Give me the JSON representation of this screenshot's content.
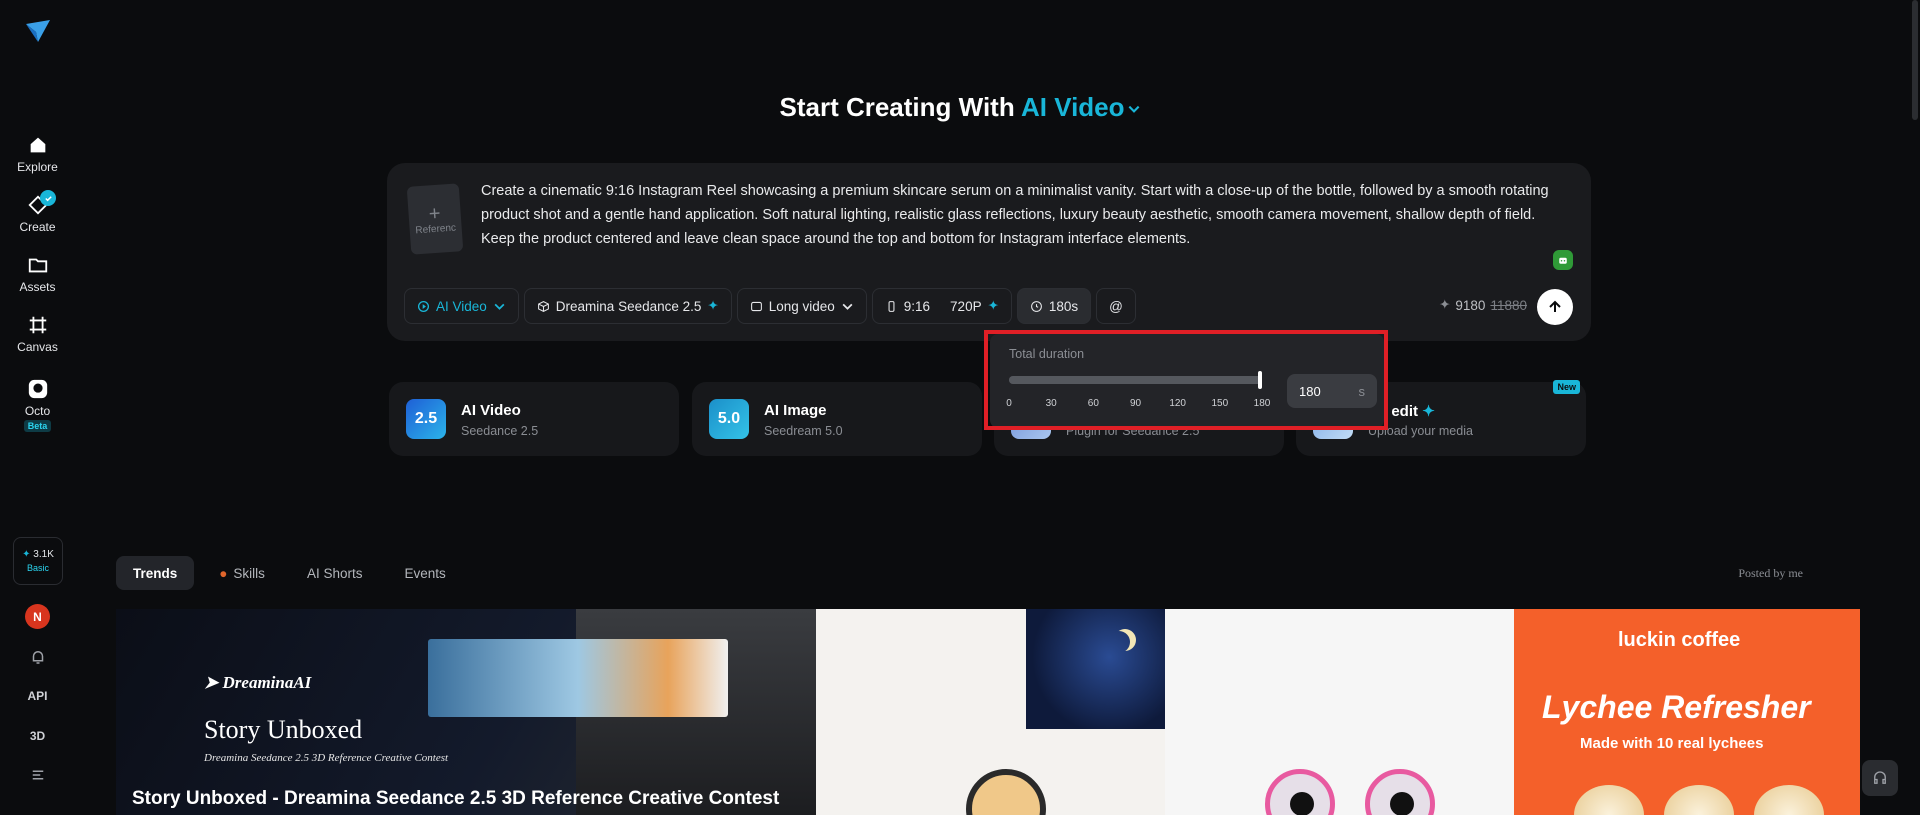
{
  "sidebar": {
    "items": [
      {
        "label": "Explore",
        "icon": "home-icon"
      },
      {
        "label": "Create",
        "icon": "create-icon"
      },
      {
        "label": "Assets",
        "icon": "folder-icon"
      },
      {
        "label": "Canvas",
        "icon": "canvas-icon"
      },
      {
        "label": "Octo",
        "icon": "octo-icon",
        "badge": "Beta"
      }
    ],
    "credits": {
      "value": "3.1K",
      "plan": "Basic"
    },
    "avatar_initial": "N",
    "api_label": "API",
    "three_d_label": "3D"
  },
  "headline": {
    "prefix": "Start Creating With",
    "accent": "AI Video"
  },
  "prompt": {
    "reference_label": "Referenc",
    "text": "Create a cinematic 9:16 Instagram Reel showcasing a premium skincare serum on a minimalist vanity. Start with a close-up of the bottle, followed by a smooth rotating product shot and a gentle hand application. Soft natural lighting, realistic glass reflections, luxury beauty aesthetic, smooth camera movement, shallow depth of field. Keep the product centered and leave clean space around the top and bottom for Instagram interface elements."
  },
  "toolbar": {
    "mode": "AI Video",
    "model": "Dreamina Seedance 2.5",
    "video_type": "Long video",
    "ratio": "9:16",
    "resolution": "720P",
    "duration": "180s",
    "mention": "@",
    "cost": "9180",
    "original_cost": "11880"
  },
  "duration_popover": {
    "label": "Total duration",
    "ticks": [
      "0",
      "30",
      "60",
      "90",
      "120",
      "150",
      "180"
    ],
    "min": 0,
    "max": 180,
    "value": 180,
    "input_value": "180",
    "unit": "s"
  },
  "tool_cards": [
    {
      "title": "AI Video",
      "sub": "Seedance 2.5",
      "icon_text": "2.5"
    },
    {
      "title": "AI Image",
      "sub": "Seedream 5.0",
      "icon_text": "5.0"
    },
    {
      "title": "",
      "sub": "Plugin for Seedance 2.5",
      "icon_text": ""
    },
    {
      "title": "art edit",
      "sub": "Upload your media",
      "icon_text": "",
      "badge": "New"
    }
  ],
  "tabs": [
    "Trends",
    "Skills",
    "AI Shorts",
    "Events"
  ],
  "posted_by": "Posted by me",
  "gallery": {
    "card1": {
      "brand": "DreaminaAI",
      "story": "Story Unboxed",
      "contest": "Dreamina Seedance 2.5 3D Reference Creative Contest",
      "title": "Story Unboxed - Dreamina Seedance 2.5 3D Reference Creative Contest"
    },
    "card4": {
      "brand": "luckin coffee",
      "big": "Lychee Refresher",
      "small": "Made with 10 real lychees"
    }
  },
  "colors": {
    "accent": "#19b6d8",
    "highlight_outline": "#e01f26",
    "background": "#0b0c0e"
  }
}
